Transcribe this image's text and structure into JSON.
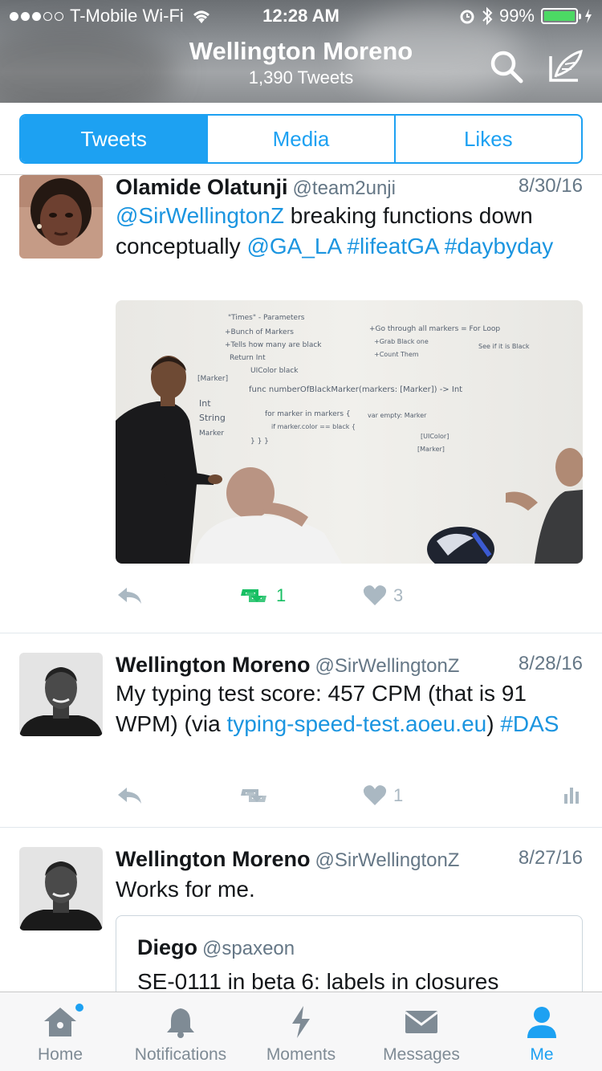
{
  "status_bar": {
    "carrier": "T-Mobile Wi-Fi",
    "time": "12:28 AM",
    "battery": "99%",
    "battery_level": 0.99
  },
  "header": {
    "name": "Wellington Moreno",
    "tweet_count": "1,390 Tweets",
    "icons": [
      "search-icon",
      "compose-icon"
    ]
  },
  "segments": {
    "tabs": [
      {
        "label": "Tweets",
        "active": true
      },
      {
        "label": "Media",
        "active": false
      },
      {
        "label": "Likes",
        "active": false
      }
    ]
  },
  "tweets": [
    {
      "name": "Olamide Olatunji",
      "handle": "@team2unji",
      "date": "8/30/16",
      "text_parts": [
        {
          "text": "@SirWellingtonZ",
          "link": true
        },
        {
          "text": " breaking functions down conceptually ",
          "link": false
        },
        {
          "text": "@GA_LA",
          "link": true
        },
        {
          "text": " ",
          "link": false
        },
        {
          "text": "#lifeatGA",
          "link": true
        },
        {
          "text": " ",
          "link": false
        },
        {
          "text": "#daybyday",
          "link": true
        }
      ],
      "retweets": "1",
      "likes": "3",
      "whiteboard_lines": [
        "\"Times\" - Parameters",
        "+Bunch of Markers",
        "+Tells how many are black",
        "Return   Int",
        "UIColor black",
        "[Marker]",
        "Int",
        "String",
        "Marker",
        "func numberOfBlackMarker(markers: [Marker]) -> Int",
        "for marker in markers {",
        "if marker.color == black {",
        "} } }",
        "+Go through all markers = For Loop",
        "+Grab Black one",
        "+Count Them",
        "See if it is Black",
        "var empty: Marker",
        "[UIColor]",
        "[Marker]"
      ]
    },
    {
      "name": "Wellington Moreno",
      "handle": "@SirWellingtonZ",
      "date": "8/28/16",
      "text_parts": [
        {
          "text": "My typing test score: 457 CPM (that is 91 WPM) (via ",
          "link": false
        },
        {
          "text": "typing-speed-test.aoeu.eu",
          "link": true
        },
        {
          "text": ") ",
          "link": false
        },
        {
          "text": "#DAS",
          "link": true
        }
      ],
      "likes": "1"
    },
    {
      "name": "Wellington Moreno",
      "handle": "@SirWellingtonZ",
      "date": "8/27/16",
      "text": "Works for me.",
      "quote": {
        "name": "Diego",
        "handle": "@spaxeon",
        "text": "SE-0111 in beta 6: labels in closures"
      }
    }
  ],
  "tabbar": {
    "tabs": [
      {
        "label": "Home",
        "icon": "home-icon",
        "badge": true
      },
      {
        "label": "Notifications",
        "icon": "bell-icon"
      },
      {
        "label": "Moments",
        "icon": "lightning-icon"
      },
      {
        "label": "Messages",
        "icon": "envelope-icon"
      },
      {
        "label": "Me",
        "icon": "person-icon",
        "active": true
      }
    ]
  }
}
